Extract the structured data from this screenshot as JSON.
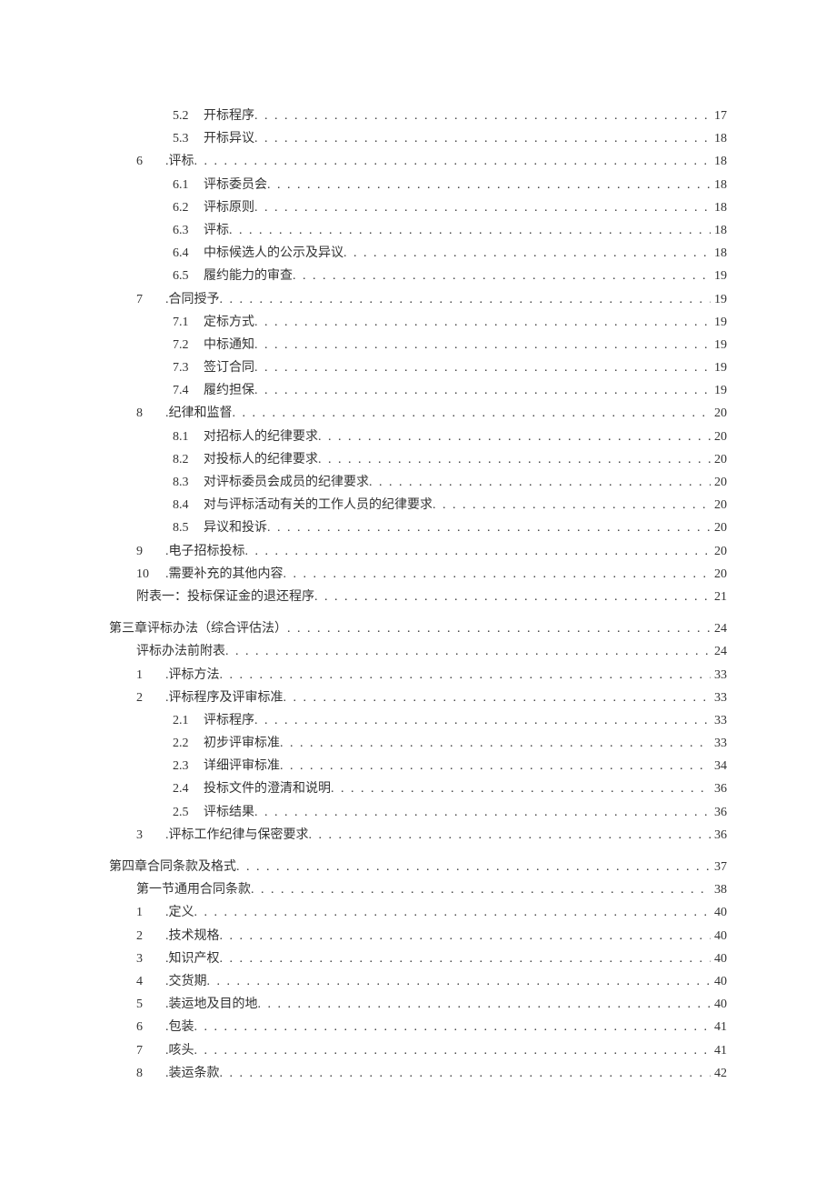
{
  "toc": [
    {
      "lvl": 3,
      "num": "5.2",
      "label": "开标程序",
      "pg": "17"
    },
    {
      "lvl": 3,
      "num": "5.3",
      "label": "开标异议",
      "pg": "18"
    },
    {
      "lvl": 2,
      "num": "6",
      "label": ".评标",
      "pg": "18"
    },
    {
      "lvl": 3,
      "num": "6.1",
      "label": "评标委员会",
      "pg": "18"
    },
    {
      "lvl": 3,
      "num": "6.2",
      "label": "评标原则",
      "pg": "18"
    },
    {
      "lvl": 3,
      "num": "6.3",
      "label": "评标",
      "pg": "18"
    },
    {
      "lvl": 3,
      "num": "6.4",
      "label": "中标候选人的公示及异议",
      "pg": "18"
    },
    {
      "lvl": 3,
      "num": "6.5",
      "label": "履约能力的审查",
      "pg": "19"
    },
    {
      "lvl": 2,
      "num": "7",
      "label": ".合同授予",
      "pg": "19"
    },
    {
      "lvl": 3,
      "num": "7.1",
      "label": "定标方式",
      "pg": "19"
    },
    {
      "lvl": 3,
      "num": "7.2",
      "label": "中标通知",
      "pg": "19"
    },
    {
      "lvl": 3,
      "num": "7.3",
      "label": "签订合同",
      "pg": "19"
    },
    {
      "lvl": 3,
      "num": "7.4",
      "label": "履约担保",
      "pg": "19"
    },
    {
      "lvl": 2,
      "num": "8",
      "label": ".纪律和监督",
      "pg": "20"
    },
    {
      "lvl": 3,
      "num": "8.1",
      "label": "对招标人的纪律要求",
      "pg": "20"
    },
    {
      "lvl": 3,
      "num": "8.2",
      "label": "对投标人的纪律要求",
      "pg": "20"
    },
    {
      "lvl": 3,
      "num": "8.3",
      "label": "对评标委员会成员的纪律要求",
      "pg": "20"
    },
    {
      "lvl": 3,
      "num": "8.4",
      "label": "对与评标活动有关的工作人员的纪律要求",
      "pg": "20"
    },
    {
      "lvl": 3,
      "num": "8.5",
      "label": "异议和投诉",
      "pg": "20"
    },
    {
      "lvl": 2,
      "num": "9",
      "label": ".电子招标投标",
      "pg": "20"
    },
    {
      "lvl": 2,
      "num": "10",
      "label": ".需要补充的其他内容",
      "pg": "20"
    },
    {
      "lvl": 2,
      "num": "",
      "label": "附表一：投标保证金的退还程序",
      "pg": "21"
    },
    {
      "lvl": 0,
      "num": "",
      "label": "第三章评标办法（综合评估法）",
      "pg": "24"
    },
    {
      "lvl": 2,
      "num": "",
      "label": "评标办法前附表",
      "pg": "24"
    },
    {
      "lvl": 2,
      "num": "1",
      "label": ".评标方法",
      "pg": "33"
    },
    {
      "lvl": 2,
      "num": "2",
      "label": ".评标程序及评审标准",
      "pg": "33"
    },
    {
      "lvl": 3,
      "num": "2.1",
      "label": "评标程序",
      "pg": "33"
    },
    {
      "lvl": 3,
      "num": "2.2",
      "label": "初步评审标准",
      "pg": "33"
    },
    {
      "lvl": 3,
      "num": "2.3",
      "label": "详细评审标准",
      "pg": "34"
    },
    {
      "lvl": 3,
      "num": "2.4",
      "label": "投标文件的澄清和说明",
      "pg": "36"
    },
    {
      "lvl": 3,
      "num": "2.5",
      "label": "评标结果",
      "pg": "36"
    },
    {
      "lvl": 2,
      "num": "3",
      "label": ".评标工作纪律与保密要求",
      "pg": "36"
    },
    {
      "lvl": 0,
      "num": "",
      "label": "第四章合同条款及格式",
      "pg": "37"
    },
    {
      "lvl": 2,
      "num": "",
      "label": "第一节通用合同条款",
      "pg": "38"
    },
    {
      "lvl": 2,
      "num": "1",
      "label": ".定义",
      "pg": "40"
    },
    {
      "lvl": 2,
      "num": "2",
      "label": ".技术规格",
      "pg": "40"
    },
    {
      "lvl": 2,
      "num": "3",
      "label": ".知识产权",
      "pg": "40"
    },
    {
      "lvl": 2,
      "num": "4",
      "label": ".交货期",
      "pg": "40"
    },
    {
      "lvl": 2,
      "num": "5",
      "label": ".装运地及目的地",
      "pg": "40"
    },
    {
      "lvl": 2,
      "num": "6",
      "label": ".包装",
      "pg": "41"
    },
    {
      "lvl": 2,
      "num": "7",
      "label": ".咳头",
      "pg": "41"
    },
    {
      "lvl": 2,
      "num": "8",
      "label": ".装运条款",
      "pg": "42"
    }
  ]
}
